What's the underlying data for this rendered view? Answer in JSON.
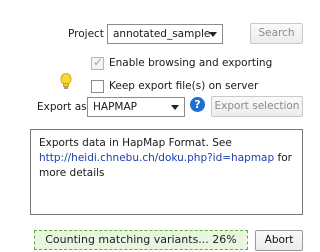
{
  "project": {
    "label": "Project",
    "value": "annotated_sample",
    "search_label": "Search"
  },
  "options": {
    "enable_browse_label": "Enable browsing and exporting",
    "enable_browse_checked": true,
    "keep_export_label": "Keep export file(s) on server",
    "keep_export_checked": false
  },
  "export": {
    "label": "Export as",
    "format": "HAPMAP",
    "help": "?",
    "export_button": "Export selection"
  },
  "description": {
    "text": "Exports data in HapMap Format. See",
    "link": "http://heidi.chnebu.ch/doku.php?id=hapmap",
    "suffix": "for more details"
  },
  "status": {
    "progress_text": "Counting matching variants... 26%",
    "progress": 0.26,
    "abort_label": "Abort"
  },
  "icons": {
    "tip": "lightbulb-icon",
    "help": "help-icon",
    "dropdown": "chevron-down-icon"
  }
}
